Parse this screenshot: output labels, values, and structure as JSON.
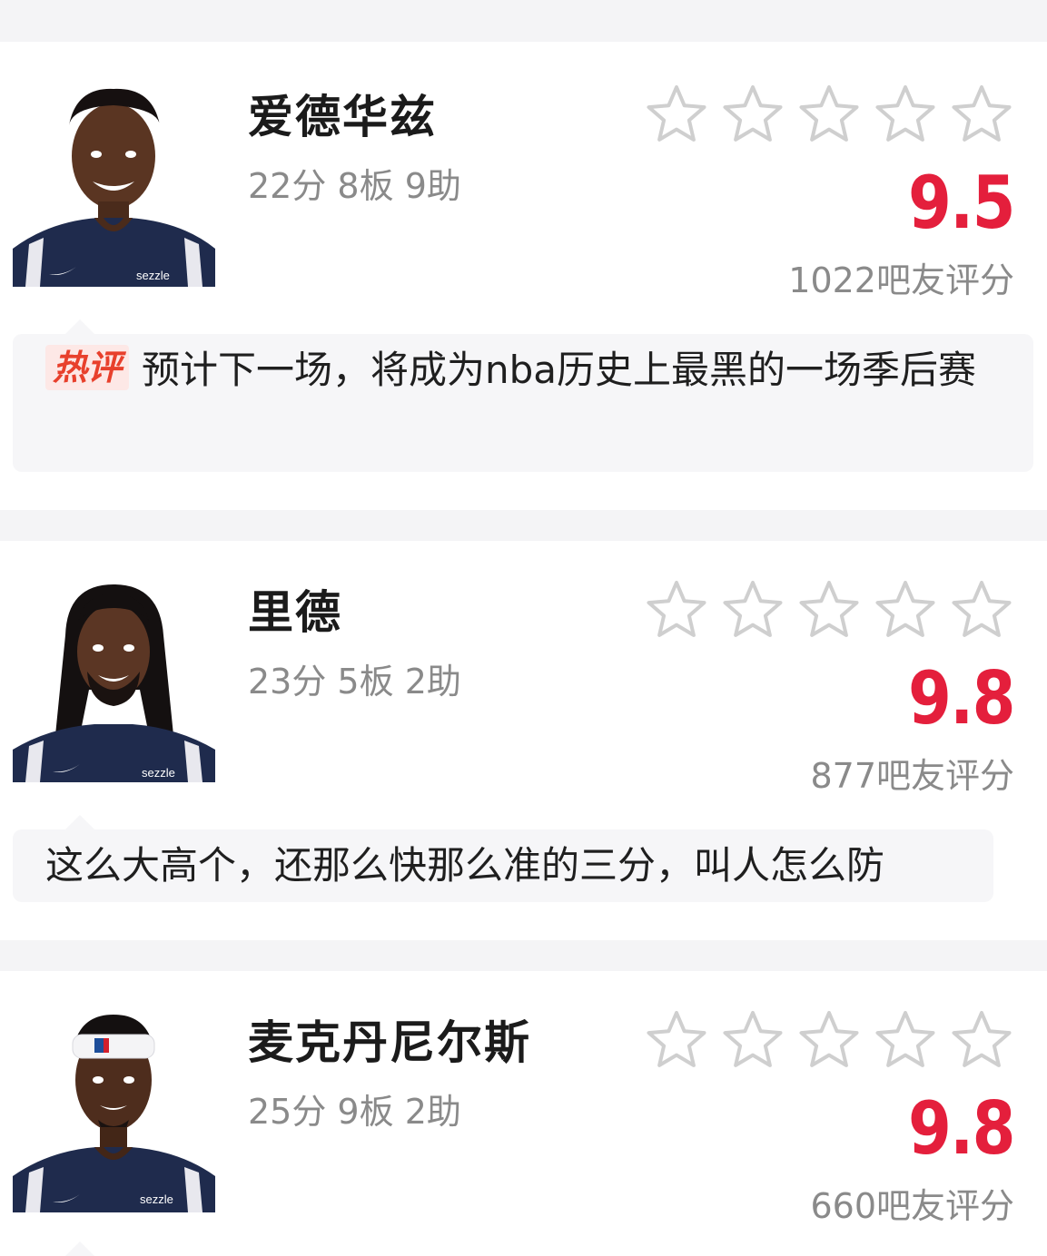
{
  "players": [
    {
      "name": "爱德华兹",
      "stats": "22分 8板 9助",
      "score": "9.5",
      "rating_count": "1022吧友评分",
      "stars_filled": 0,
      "comment": {
        "tag": "热评",
        "text": "预计下一场，将成为nba历史上最黑的一场季后赛"
      }
    },
    {
      "name": "里德",
      "stats": "23分 5板 2助",
      "score": "9.8",
      "rating_count": "877吧友评分",
      "stars_filled": 0,
      "comment": {
        "tag": "",
        "text": "这么大高个，还那么快那么准的三分，叫人怎么防"
      }
    },
    {
      "name": "麦克丹尼尔斯",
      "stats": "25分 9板 2助",
      "score": "9.8",
      "rating_count": "660吧友评分",
      "stars_filled": 0
    }
  ],
  "jersey_brand": "sezzle",
  "colors": {
    "score": "#e41f3c",
    "muted": "#8a8a8a",
    "separator": "#f4f4f6",
    "comment_bg": "#f6f6f8",
    "hot_tag": "#e8402c"
  }
}
